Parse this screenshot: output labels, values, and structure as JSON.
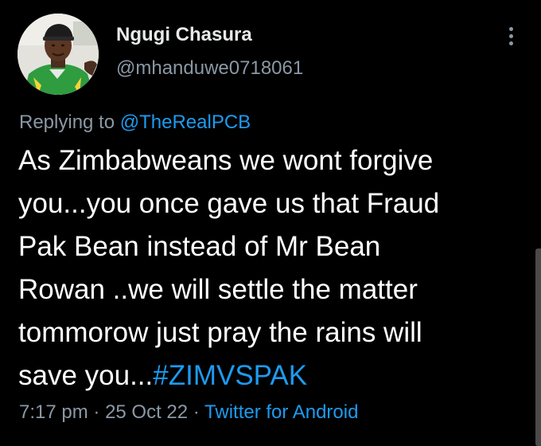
{
  "author": {
    "display_name": "Ngugi Chasura",
    "handle": "@mhanduwe0718061",
    "avatar_icon": "profile-photo"
  },
  "more_icon": "more-vertical-icon",
  "reply": {
    "prefix": "Replying to",
    "mention": "@TheRealPCB"
  },
  "tweet": {
    "lines": [
      "As Zimbabweans we wont forgive",
      "you...you once gave us that Fraud",
      "Pak Bean instead of Mr Bean",
      "Rowan ..we will settle the matter",
      "tommorow just pray the rains will"
    ],
    "last_line_text": "save you...",
    "hashtag": "#ZIMVSPAK"
  },
  "meta": {
    "time": "7:17 pm",
    "separator": "·",
    "date": "25 Oct 22",
    "source": "Twitter for Android"
  },
  "colors": {
    "background": "#000000",
    "text": "#ffffff",
    "secondary": "#8b98a5",
    "link": "#1d9bf0"
  }
}
